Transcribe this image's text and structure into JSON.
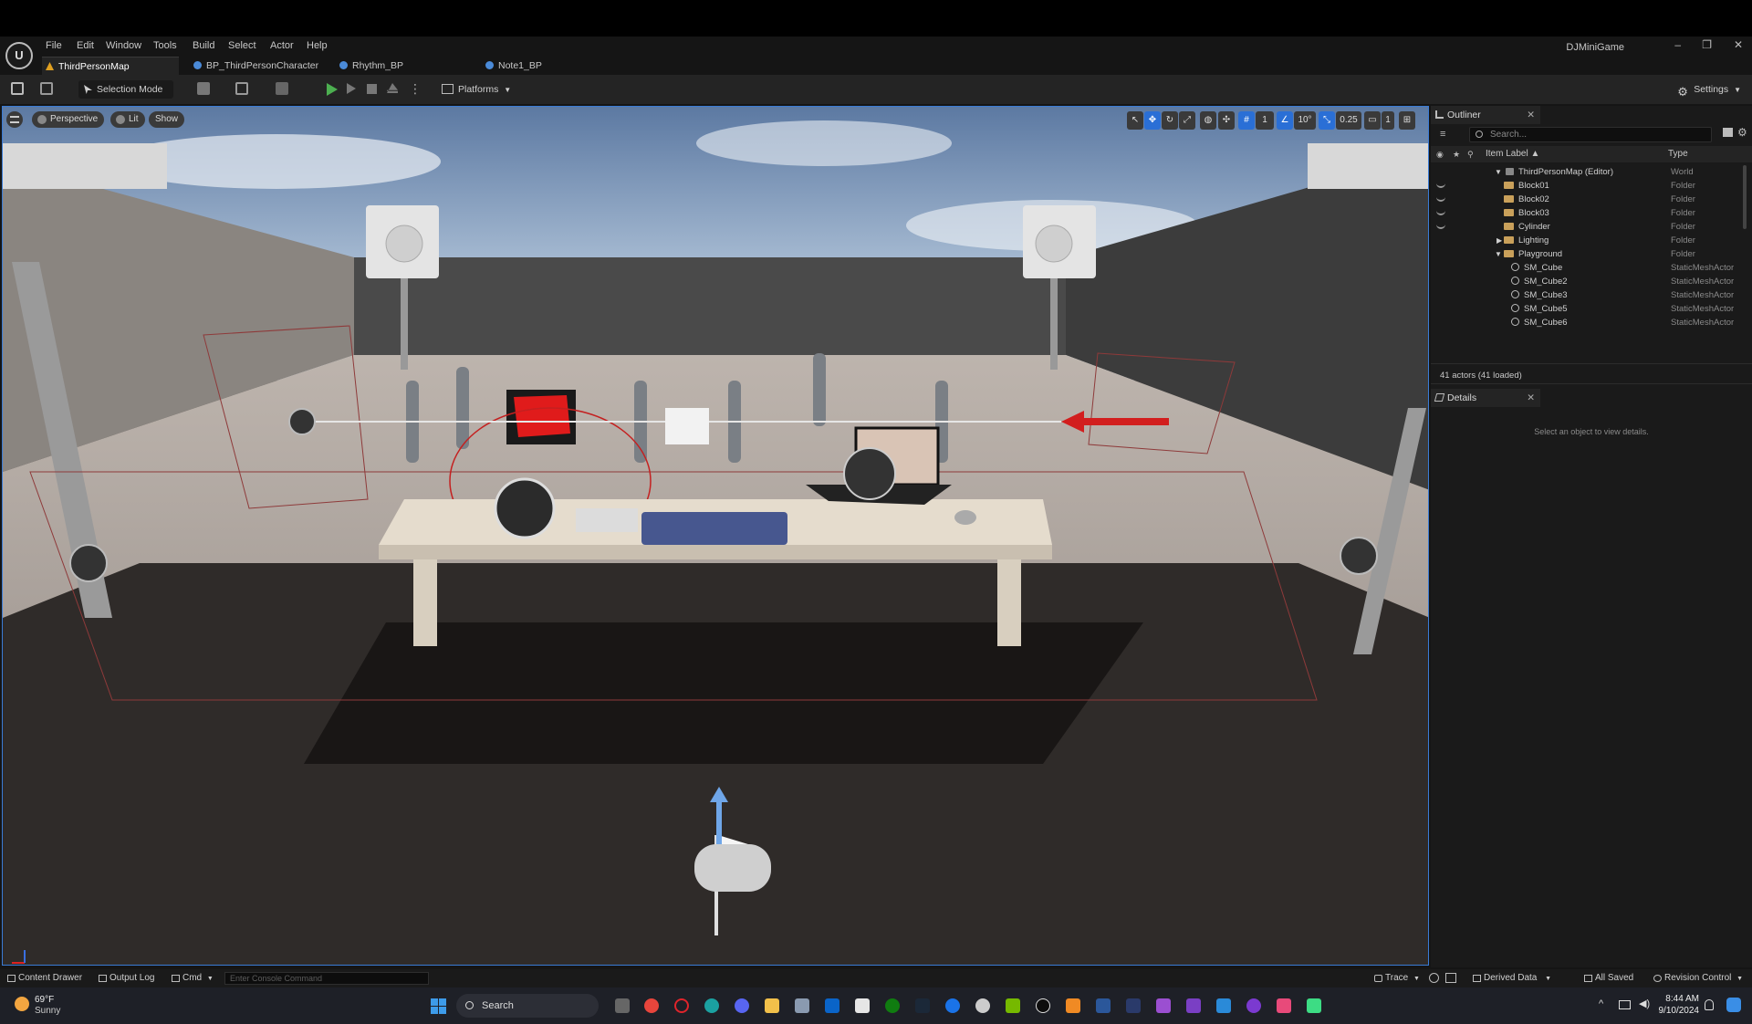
{
  "menubar": {
    "items": [
      "File",
      "Edit",
      "Window",
      "Tools",
      "Build",
      "Select",
      "Actor",
      "Help"
    ],
    "app_title": "DJMiniGame"
  },
  "tabs": [
    {
      "label": "ThirdPersonMap",
      "active": true
    },
    {
      "label": "BP_ThirdPersonCharacter",
      "active": false
    },
    {
      "label": "Rhythm_BP",
      "active": false
    },
    {
      "label": "Note1_BP",
      "active": false
    }
  ],
  "toolbar": {
    "selection_mode": "Selection Mode",
    "platforms": "Platforms",
    "settings": "Settings"
  },
  "viewport": {
    "view_mode": "Perspective",
    "lighting": "Lit",
    "show": "Show",
    "grid_snap": "1",
    "rotation_snap": "10°",
    "scale_snap": "0.25",
    "camera_speed": "1"
  },
  "outliner": {
    "tab_label": "Outliner",
    "search_placeholder": "Search...",
    "col_label": "Item Label ▲",
    "col_type": "Type",
    "rows": [
      {
        "label": "ThirdPersonMap (Editor)",
        "type": "World"
      },
      {
        "label": "Block01",
        "type": "Folder"
      },
      {
        "label": "Block02",
        "type": "Folder"
      },
      {
        "label": "Block03",
        "type": "Folder"
      },
      {
        "label": "Cylinder",
        "type": "Folder"
      },
      {
        "label": "Lighting",
        "type": "Folder"
      },
      {
        "label": "Playground",
        "type": "Folder"
      },
      {
        "label": "SM_Cube",
        "type": "StaticMeshActor"
      },
      {
        "label": "SM_Cube2",
        "type": "StaticMeshActor"
      },
      {
        "label": "SM_Cube3",
        "type": "StaticMeshActor"
      },
      {
        "label": "SM_Cube5",
        "type": "StaticMeshActor"
      },
      {
        "label": "SM_Cube6",
        "type": "StaticMeshActor"
      }
    ],
    "actor_count": "41 actors (41 loaded)"
  },
  "details": {
    "tab_label": "Details",
    "empty_text": "Select an object to view details."
  },
  "bottombar": {
    "content_drawer": "Content Drawer",
    "output_log": "Output Log",
    "cmd": "Cmd",
    "console_placeholder": "Enter Console Command",
    "trace": "Trace",
    "derived_data": "Derived Data",
    "all_saved": "All Saved",
    "revision_control": "Revision Control"
  },
  "taskbar": {
    "temperature": "69°F",
    "weather": "Sunny",
    "search": "Search",
    "time": "8:44 AM",
    "date": "9/10/2024"
  },
  "colors": {
    "accent_blue": "#2a6fd6",
    "play_green": "#4caf50",
    "folder": "#c9a05a"
  }
}
